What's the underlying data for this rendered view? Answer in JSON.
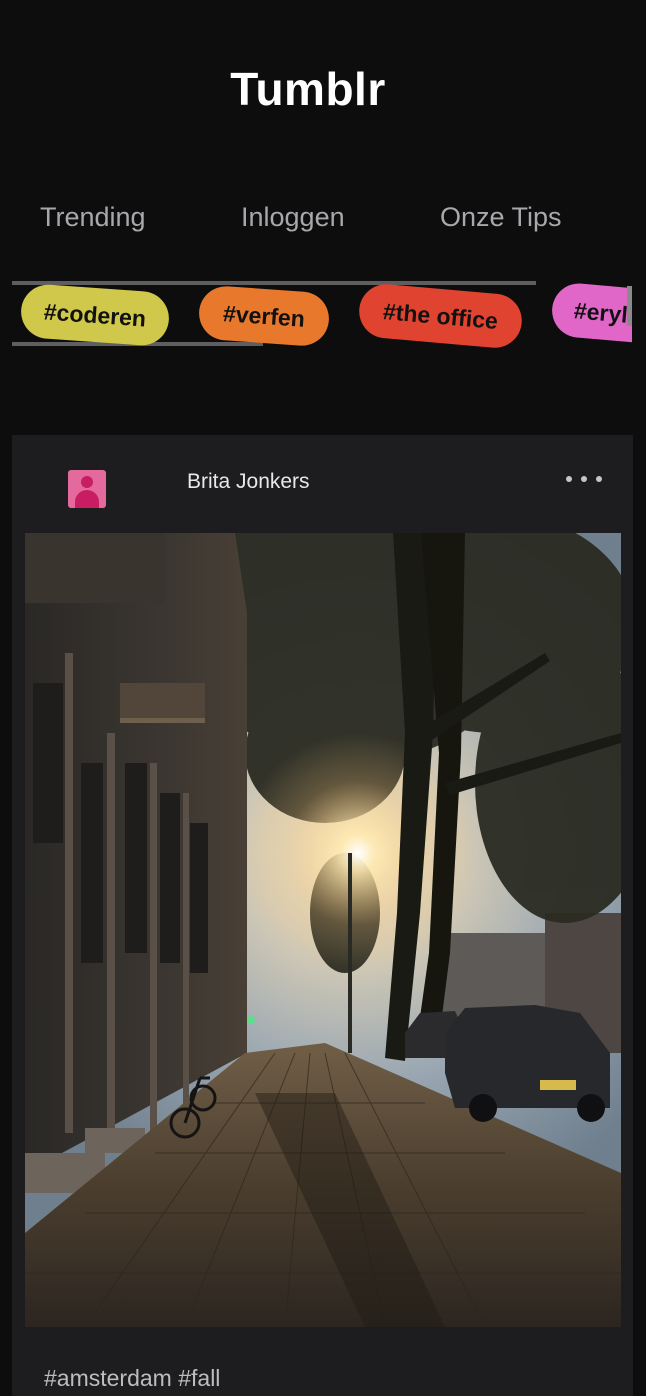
{
  "app": {
    "title": "Tumblr"
  },
  "nav": {
    "tabs": [
      {
        "label": "Trending"
      },
      {
        "label": "Inloggen"
      },
      {
        "label": "Onze Tips"
      }
    ]
  },
  "tags": [
    {
      "label": "#coderen",
      "color": "#cfc84a"
    },
    {
      "label": "#verfen",
      "color": "#e8782c"
    },
    {
      "label": "#the office",
      "color": "#e0432f"
    },
    {
      "label": "#eryl",
      "color": "#e066c8"
    }
  ],
  "post": {
    "author": "Brita Jonkers",
    "avatar_icon": "user-avatar-icon",
    "more_icon": "more-dots-icon",
    "photo_subject": "photo",
    "tags_text": "#amsterdam #fall"
  },
  "colors": {
    "background": "#0d0d0e",
    "card": "#1d1d1f",
    "nav_text": "#a8a8ac"
  }
}
